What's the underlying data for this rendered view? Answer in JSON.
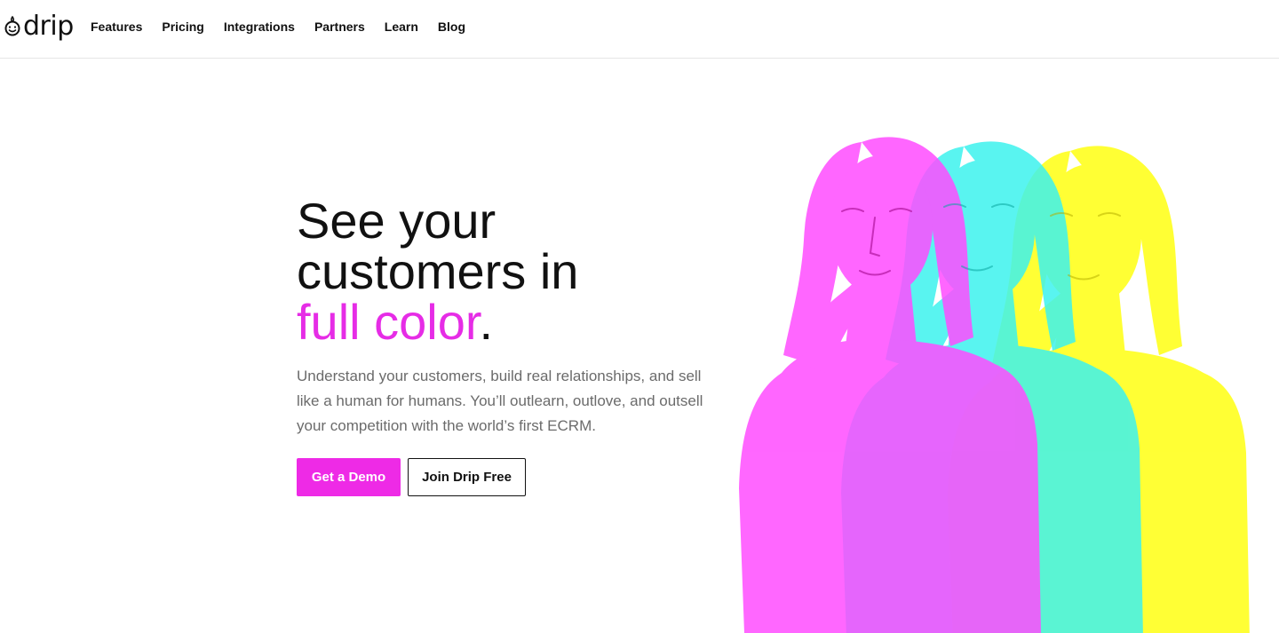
{
  "brand": {
    "logo_text": "drip",
    "logo_icon": "smile-drop-icon"
  },
  "nav": {
    "items": [
      {
        "label": "Features"
      },
      {
        "label": "Pricing"
      },
      {
        "label": "Integrations"
      },
      {
        "label": "Partners"
      },
      {
        "label": "Learn"
      },
      {
        "label": "Blog"
      }
    ]
  },
  "hero": {
    "headline_line1": "See your",
    "headline_line2": "customers in",
    "headline_accent": "full color",
    "headline_period": ".",
    "subtext": "Understand your customers, build real relationships, and sell like a human for humans. You’ll outlearn, outlove, and outsell your competition with the world’s first ECRM.",
    "primary_cta": "Get a Demo",
    "secondary_cta": "Join Drip Free",
    "image_semantic": "tri-color-woman-portrait"
  },
  "colors": {
    "accent": "#ee2ae6",
    "magenta": "#ff33ff",
    "cyan": "#33eaff",
    "yellow": "#ffff22",
    "text": "#111111",
    "muted": "#6b6b6b"
  }
}
